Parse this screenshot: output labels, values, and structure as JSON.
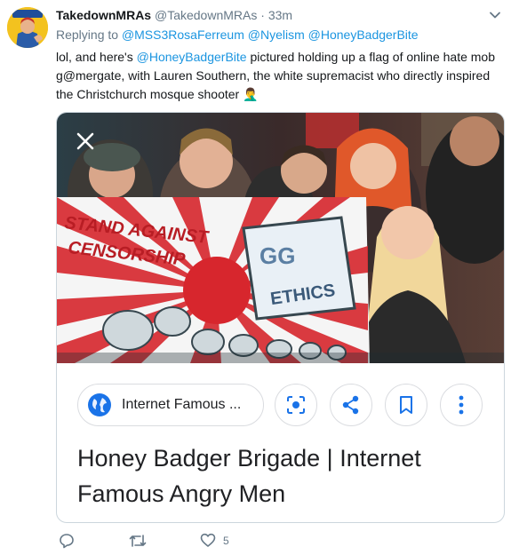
{
  "tweet": {
    "display_name": "TakedownMRAs",
    "handle": "@TakedownMRAs",
    "separator": "·",
    "time": "33m",
    "reply_prefix": "Replying to",
    "reply_mentions": [
      "@MSS3RosaFerreum",
      "@Nyelism",
      "@HoneyBadgerBite"
    ],
    "text_part1": "lol, and here's ",
    "text_mention": "@HoneyBadgerBite",
    "text_part2": " pictured holding up a flag of online hate mob g@mergate, with Lauren Southern, the white supremacist who directly inspired the Christchurch mosque shooter",
    "emoji": "🤦‍♂️"
  },
  "avatar": {
    "caption": "We Can Do It!"
  },
  "card": {
    "banner_text": [
      "STAND AGAINST",
      "CENSORSHIP"
    ],
    "flag_logo_text": "GG",
    "flag_text": "ETHICS",
    "source_label": "Internet Famous ...",
    "title": "Honey Badger Brigade | Internet Famous Angry Men"
  },
  "actions": {
    "like_count": "5"
  },
  "icons": {
    "caret": "chevron-down-icon",
    "close": "close-icon",
    "globe": "globe-icon",
    "lens": "lens-icon",
    "share": "share-icon",
    "bookmark": "bookmark-icon",
    "more": "more-vertical-icon",
    "reply": "reply-icon",
    "retweet": "retweet-icon",
    "like": "heart-icon"
  },
  "colors": {
    "link": "#1b95e0",
    "muted": "#657786",
    "google_blue": "#1a73e8",
    "border": "#ccd6dd"
  }
}
